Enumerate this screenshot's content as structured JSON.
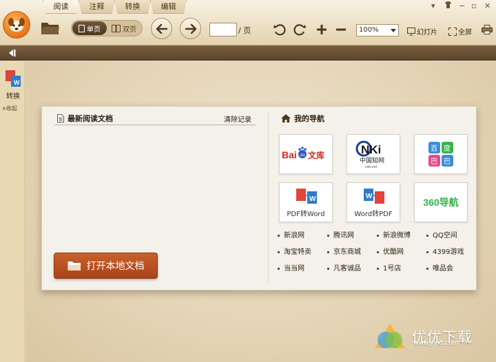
{
  "menu_tabs": [
    "阅读",
    "注释",
    "转换",
    "编辑"
  ],
  "toolbar": {
    "single_page": "单页",
    "double_page": "双页",
    "page_suffix": "/ 页",
    "zoom": "100%",
    "slideshow": "幻灯片",
    "fullscreen": "全屏"
  },
  "sidebar": {
    "convert": "转换",
    "collapse": "∧收起"
  },
  "recent": {
    "title": "最新阅读文档",
    "clear": "清除记录",
    "open_local": "打开本地文档"
  },
  "navigation": {
    "title": "我的导航",
    "tiles": [
      {
        "name": "baidu-wenku",
        "text": "Bai文库"
      },
      {
        "name": "cnki",
        "text": "CNKi 中国知网"
      },
      {
        "name": "baidu-baike",
        "text": "百度 巴巴"
      },
      {
        "name": "pdf-to-word",
        "text": "PDF转Word"
      },
      {
        "name": "word-to-pdf",
        "text": "Word转PDF"
      },
      {
        "name": "360-nav",
        "text": "360导航"
      }
    ],
    "links": [
      "新浪网",
      "腾讯网",
      "新浪微博",
      "QQ空间",
      "淘宝特卖",
      "京东商城",
      "优酷网",
      "4399游戏",
      "当当网",
      "凡客诚品",
      "1号店",
      "唯品会"
    ]
  },
  "watermark": {
    "text": "优优下载",
    "url": "www.yyxt.com"
  },
  "colors": {
    "accent_orange": "#b84f22",
    "toolbar_bg": "#ecdfc4",
    "subbar_brown": "#5b452b"
  }
}
